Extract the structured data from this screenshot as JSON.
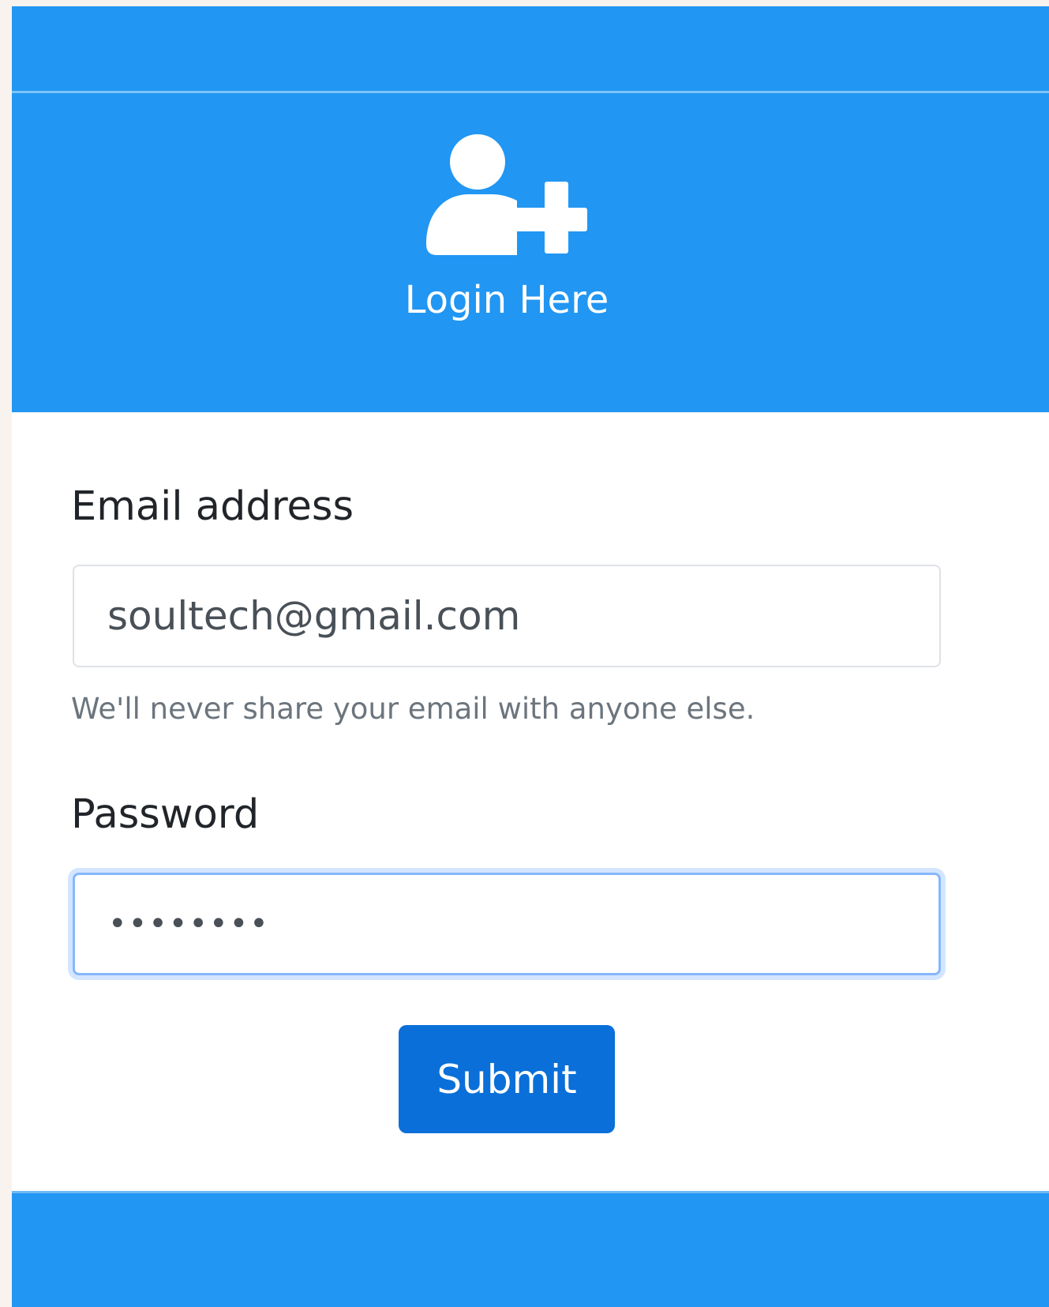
{
  "header": {
    "icon": "user-plus-icon",
    "title": "Login Here"
  },
  "form": {
    "email_label": "Email address",
    "email_value": "soultech@gmail.com",
    "email_help": "We'll never share your email with anyone else.",
    "password_label": "Password",
    "password_value": "••••••••",
    "submit_label": "Submit"
  },
  "colors": {
    "header_background": "#2196f3",
    "submit_button": "#0a6fd8",
    "focus_ring": "#86b7fe"
  }
}
